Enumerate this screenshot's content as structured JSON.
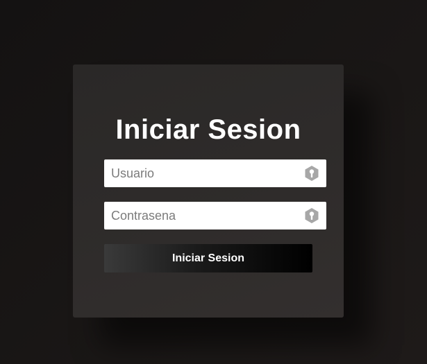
{
  "login": {
    "title": "Iniciar Sesion",
    "username_placeholder": "Usuario",
    "username_value": "",
    "username_icon": "key-icon",
    "password_placeholder": "Contrasena",
    "password_value": "",
    "password_icon": "key-icon",
    "submit_label": "Iniciar Sesion"
  },
  "colors": {
    "background": "#161312",
    "card": "#2f2c2b",
    "title_text": "#ffffff",
    "input_bg": "#ffffff",
    "icon": "#a7a7a7",
    "button_start": "#3a3a3a",
    "button_end": "#000000"
  }
}
